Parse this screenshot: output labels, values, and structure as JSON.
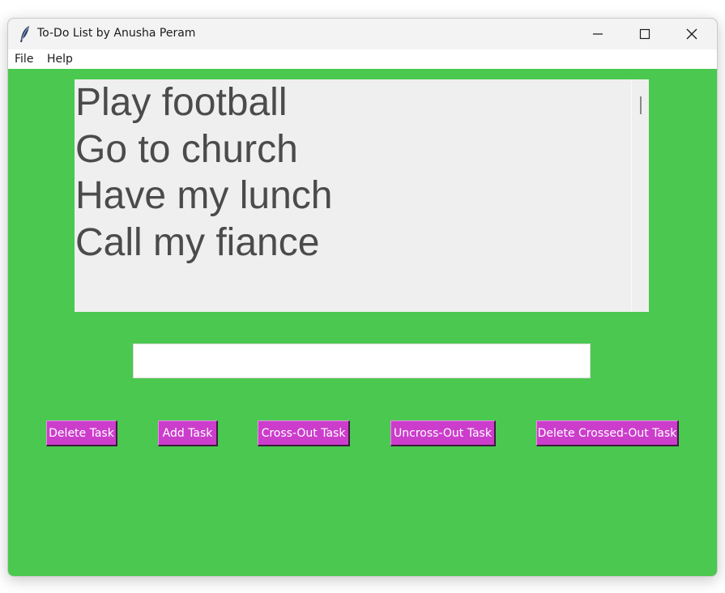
{
  "window": {
    "title": "To-Do List by Anusha Peram",
    "icon": "feather-icon",
    "controls": [
      "minimize-icon",
      "maximize-icon",
      "close-icon"
    ]
  },
  "menu": {
    "items": [
      {
        "label": "File"
      },
      {
        "label": "Help"
      }
    ]
  },
  "tasks": {
    "items": [
      "Play football",
      "Go to church",
      "Have my lunch",
      "Call my fiance"
    ]
  },
  "entry": {
    "value": "",
    "placeholder": ""
  },
  "buttons": {
    "delete_task": "Delete Task",
    "add_task": "Add Task",
    "cross_out": "Cross-Out Task",
    "uncross_out": "Uncross-Out Task",
    "delete_crossed": "Delete Crossed-Out Task"
  },
  "colors": {
    "background": "#4bc84f",
    "button": "#cc3dcc",
    "button_text": "#ffffff",
    "listbox": "#efefef",
    "list_text": "#4b4b4b"
  }
}
